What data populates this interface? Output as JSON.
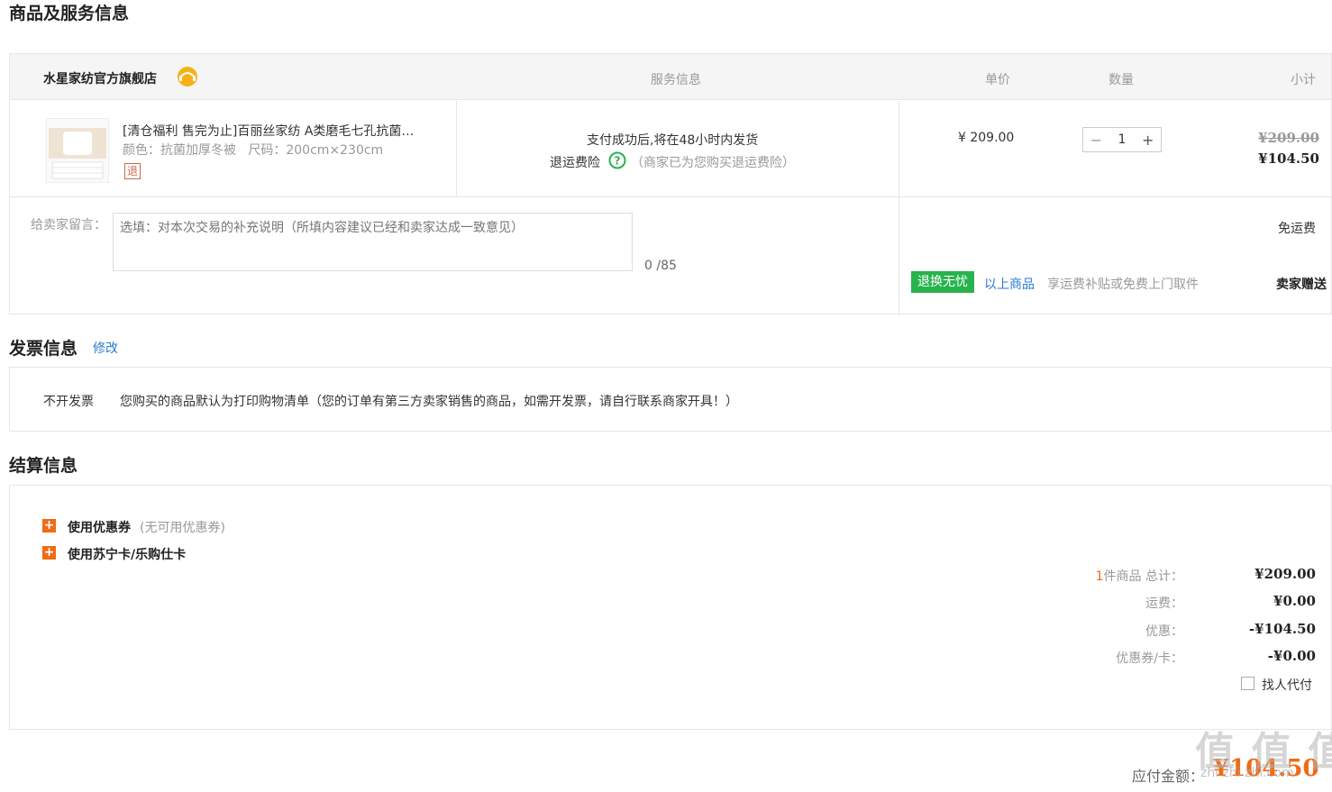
{
  "section1": {
    "title": "商品及服务信息"
  },
  "table_header": {
    "shop_name": "水星家纺官方旗舰店",
    "service": "服务信息",
    "price": "单价",
    "qty": "数量",
    "subtotal": "小计"
  },
  "product": {
    "name": "[清仓福利 售完为止]百丽丝家纺 A类磨毛七孔抗菌…",
    "attrs": "颜色：抗菌加厚冬被   尺码：200cm×230cm",
    "return_badge": "退",
    "delivery": "支付成功后,将在48小时内发货",
    "insurance_label": "退运费险",
    "insurance_note": "（商家已为您购买退运费险）",
    "price": "¥ 209.00",
    "quantity": "1",
    "original_price": "¥209.00",
    "final_price": "¥104.50"
  },
  "message": {
    "label": "给卖家留言：",
    "placeholder": "选填：对本次交易的补充说明（所填内容建议已经和卖家达成一致意见）",
    "counter": "0 /85"
  },
  "shipping": {
    "free": "免运费",
    "badge": "退换无忧",
    "link": "以上商品",
    "desc": "享运费补贴或免费上门取件",
    "gift": "卖家赠送"
  },
  "invoice": {
    "title": "发票信息",
    "edit": "修改",
    "type": "不开发票",
    "desc": "您购买的商品默认为打印购物清单（您的订单有第三方卖家销售的商品，如需开发票，请自行联系商家开具！）"
  },
  "settlement": {
    "title": "结算信息",
    "coupon_label": "使用优惠券",
    "coupon_note": "(无可用优惠券)",
    "card_label": "使用苏宁卡/乐购仕卡",
    "count_prefix": "1",
    "total_label": "件商品 总计：",
    "total": "¥209.00",
    "freight_label": "运费：",
    "freight": "¥0.00",
    "discount_label": "优惠：",
    "discount": "-¥104.50",
    "coupon_card_label": "优惠券/卡：",
    "coupon_card": "-¥0.00",
    "pay_for_me": "找人代付"
  },
  "payable": {
    "label": "应付金额：",
    "amount": "¥104.50"
  },
  "watermark": "值  值  值",
  "watermark_sub": "zhi zhi zhi.com",
  "colors": {
    "accent": "#ef6b16",
    "link": "#2a7ad2",
    "green": "#28b34c",
    "price_red": "#e4393c"
  }
}
